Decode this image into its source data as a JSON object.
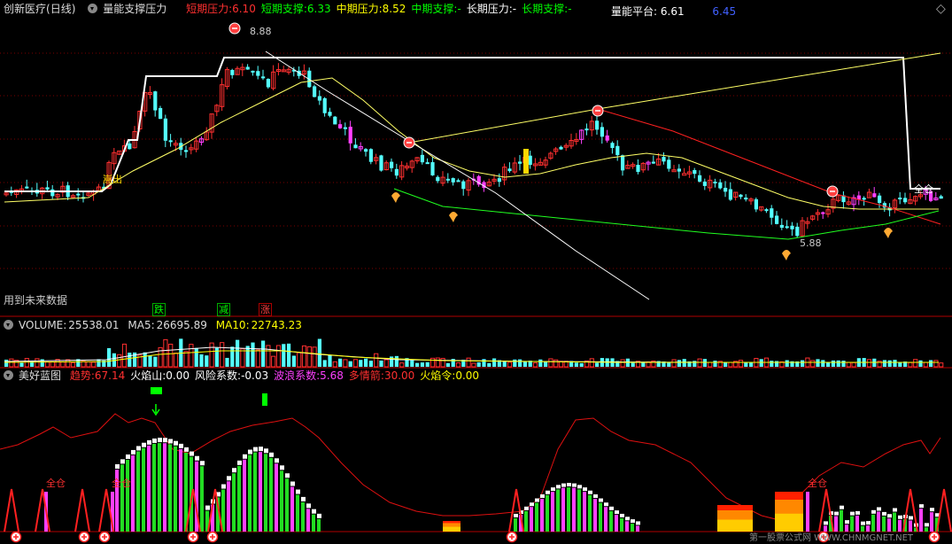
{
  "main_header": {
    "stock": "创新医疗",
    "period": "(日线)",
    "indicator": "量能支撑压力",
    "items": [
      {
        "label": "短期压力:",
        "value": "6.10",
        "color": "#ff3030"
      },
      {
        "label": "短期支撑:",
        "value": "6.33",
        "color": "#00ff00"
      },
      {
        "label": "中期压力:",
        "value": "8.52",
        "color": "#ffff00"
      },
      {
        "label": "中期支撑:",
        "value": "-",
        "color": "#00ff00"
      },
      {
        "label": "长期压力:",
        "value": "-",
        "color": "#ffffff"
      },
      {
        "label": "长期支撑:",
        "value": "-",
        "color": "#00ff00"
      }
    ],
    "platform_label": "量能平台:",
    "platform_value": "6.61",
    "extra_value": "6.45"
  },
  "main_chart": {
    "high_label": "8.88",
    "low_label": "5.88",
    "future_data_text": "用到未来数据",
    "tags": [
      {
        "text": "跌",
        "color": "#00ff00"
      },
      {
        "text": "减",
        "color": "#00ff00"
      },
      {
        "text": "涨",
        "color": "#ff4040"
      }
    ],
    "chip_left": "嵩出",
    "chip_right": "全仓"
  },
  "volume_header": {
    "label": "VOLUME:",
    "value": "25538.01",
    "ma5_label": "MA5:",
    "ma5_value": "26695.89",
    "ma10_label": "MA10:",
    "ma10_value": "22743.23"
  },
  "bottom_header": {
    "indicator": "美好蓝图",
    "items": [
      {
        "label": "趋势:",
        "value": "67.14",
        "color": "#ff3030"
      },
      {
        "label": "火焰山:",
        "value": "0.00",
        "color": "#ffffff"
      },
      {
        "label": "风险系数:",
        "value": "-0.03",
        "color": "#ffffff"
      },
      {
        "label": "波浪系数:",
        "value": "5.68",
        "color": "#ff40ff"
      },
      {
        "label": "多情箭:",
        "value": "30.00",
        "color": "#ff3030"
      },
      {
        "label": "火焰令:",
        "value": "0.00",
        "color": "#ffff00"
      }
    ]
  },
  "bottom_chart": {
    "full_pos_label": "全仓",
    "watermark": "第一股票公式网 WWW.CHNMGNET.NET"
  }
}
